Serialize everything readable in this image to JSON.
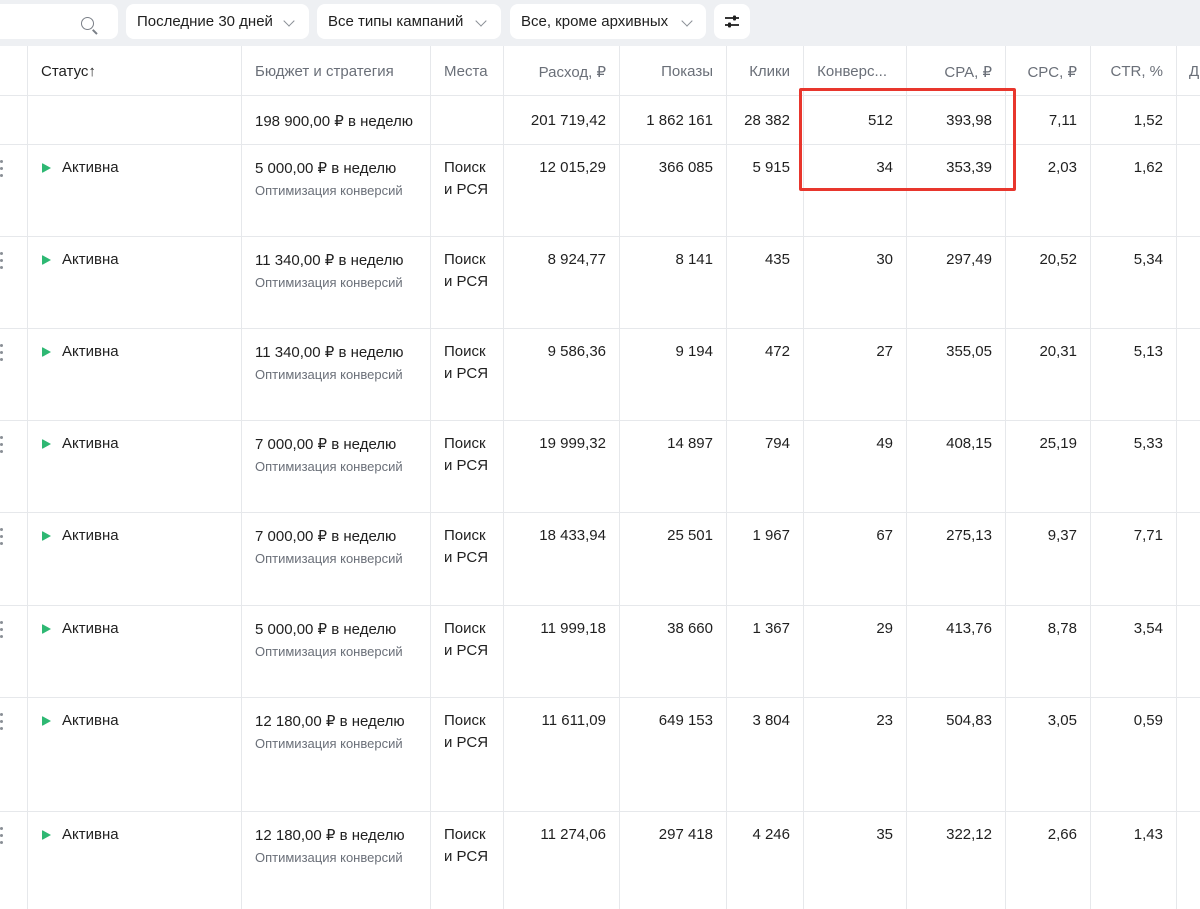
{
  "toolbar": {
    "search_value": "",
    "period": "Последние 30 дней",
    "campaign_types": "Все типы кампаний",
    "archive_filter": "Все, кроме архивных"
  },
  "table": {
    "headers": {
      "status": "Статус↑",
      "budget": "Бюджет и стратегия",
      "places": "Места",
      "spend": "Расход, ₽",
      "impressions": "Показы",
      "clicks": "Клики",
      "conversions": "Конверс...",
      "cpa": "CPA, ₽",
      "cpc": "CPC, ₽",
      "ctr": "CTR, %",
      "more": "Д"
    },
    "totals": {
      "budget": "198 900,00 ₽ в неделю",
      "spend": "201 719,42",
      "impressions": "1 862 161",
      "clicks": "28 382",
      "conversions": "512",
      "cpa": "393,98",
      "cpc": "7,11",
      "ctr": "1,52"
    },
    "rows": [
      {
        "status": "Активна",
        "budget": "5 000,00 ₽ в неделю",
        "strategy": "Оптимизация конверсий",
        "places1": "Поиск",
        "places2": "и РСЯ",
        "spend": "12 015,29",
        "impressions": "366 085",
        "clicks": "5 915",
        "conversions": "34",
        "cpa": "353,39",
        "cpc": "2,03",
        "ctr": "1,62"
      },
      {
        "status": "Активна",
        "budget": "11 340,00 ₽ в неделю",
        "strategy": "Оптимизация конверсий",
        "places1": "Поиск",
        "places2": "и РСЯ",
        "spend": "8 924,77",
        "impressions": "8 141",
        "clicks": "435",
        "conversions": "30",
        "cpa": "297,49",
        "cpc": "20,52",
        "ctr": "5,34"
      },
      {
        "status": "Активна",
        "budget": "11 340,00 ₽ в неделю",
        "strategy": "Оптимизация конверсий",
        "places1": "Поиск",
        "places2": "и РСЯ",
        "spend": "9 586,36",
        "impressions": "9 194",
        "clicks": "472",
        "conversions": "27",
        "cpa": "355,05",
        "cpc": "20,31",
        "ctr": "5,13"
      },
      {
        "status": "Активна",
        "budget": "7 000,00 ₽ в неделю",
        "strategy": "Оптимизация конверсий",
        "places1": "Поиск",
        "places2": "и РСЯ",
        "spend": "19 999,32",
        "impressions": "14 897",
        "clicks": "794",
        "conversions": "49",
        "cpa": "408,15",
        "cpc": "25,19",
        "ctr": "5,33"
      },
      {
        "status": "Активна",
        "budget": "7 000,00 ₽ в неделю",
        "strategy": "Оптимизация конверсий",
        "places1": "Поиск",
        "places2": "и РСЯ",
        "spend": "18 433,94",
        "impressions": "25 501",
        "clicks": "1 967",
        "conversions": "67",
        "cpa": "275,13",
        "cpc": "9,37",
        "ctr": "7,71"
      },
      {
        "status": "Активна",
        "budget": "5 000,00 ₽ в неделю",
        "strategy": "Оптимизация конверсий",
        "places1": "Поиск",
        "places2": "и РСЯ",
        "spend": "11 999,18",
        "impressions": "38 660",
        "clicks": "1 367",
        "conversions": "29",
        "cpa": "413,76",
        "cpc": "8,78",
        "ctr": "3,54"
      },
      {
        "status": "Активна",
        "budget": "12 180,00 ₽ в неделю",
        "strategy": "Оптимизация конверсий",
        "places1": "Поиск",
        "places2": "и РСЯ",
        "spend": "11 611,09",
        "impressions": "649 153",
        "clicks": "3 804",
        "conversions": "23",
        "cpa": "504,83",
        "cpc": "3,05",
        "ctr": "0,59"
      },
      {
        "status": "Активна",
        "budget": "12 180,00 ₽ в неделю",
        "strategy": "Оптимизация конверсий",
        "places1": "Поиск",
        "places2": "и РСЯ",
        "spend": "11 274,06",
        "impressions": "297 418",
        "clicks": "4 246",
        "conversions": "35",
        "cpa": "322,12",
        "cpc": "2,66",
        "ctr": "1,43"
      }
    ]
  },
  "colors": {
    "status_active": "#2eb873",
    "highlight": "#e8362d"
  }
}
